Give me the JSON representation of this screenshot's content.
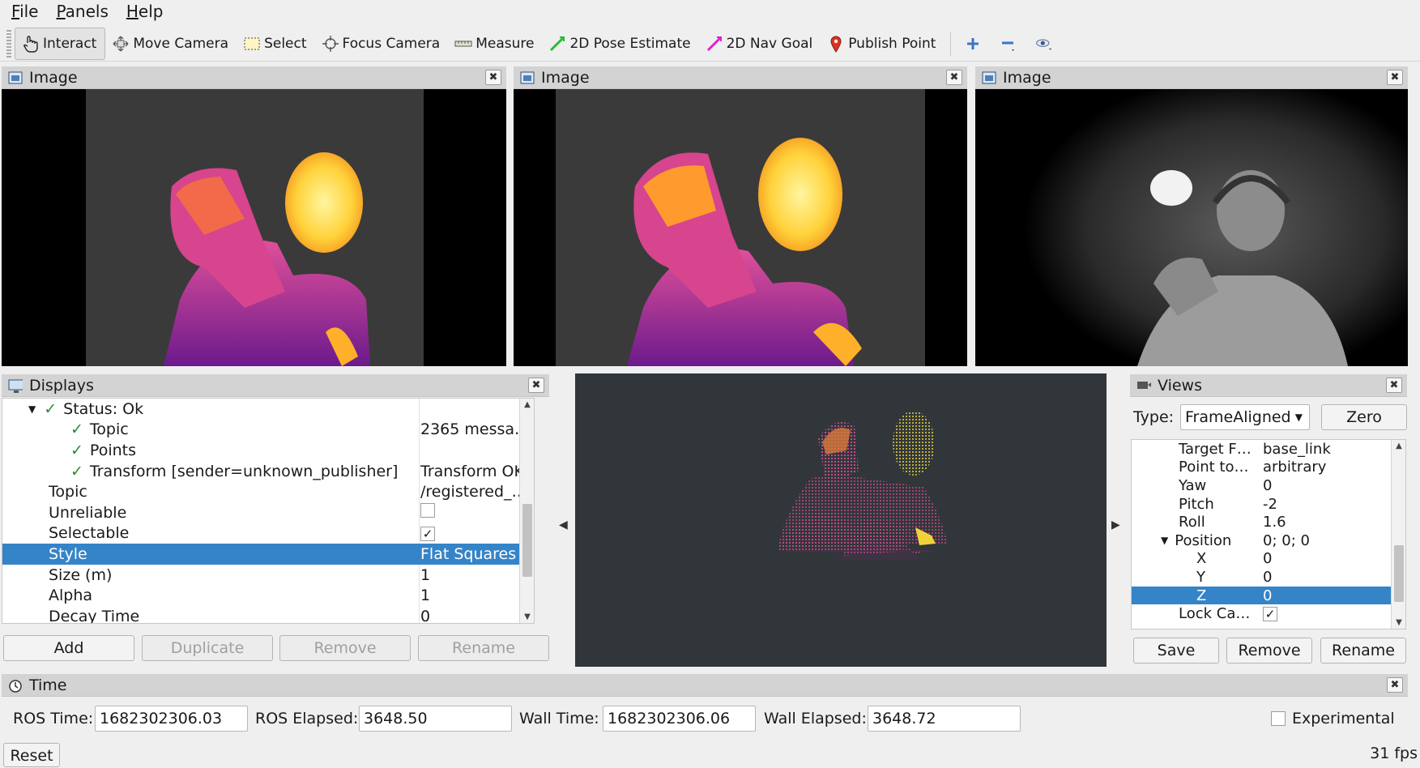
{
  "menu": [
    {
      "letter": "F",
      "rest": "ile"
    },
    {
      "letter": "P",
      "rest": "anels"
    },
    {
      "letter": "H",
      "rest": "elp"
    }
  ],
  "toolbar": {
    "interact": "Interact",
    "move_camera": "Move Camera",
    "select": "Select",
    "focus_camera": "Focus Camera",
    "measure": "Measure",
    "pose_estimate": "2D Pose Estimate",
    "nav_goal": "2D Nav Goal",
    "publish_point": "Publish Point"
  },
  "image_panels": [
    {
      "title": "Image",
      "icon": "image-icon"
    },
    {
      "title": "Image",
      "icon": "image-icon"
    },
    {
      "title": "Image",
      "icon": "image-icon"
    }
  ],
  "displays": {
    "title": "Displays",
    "rows": [
      {
        "name": "Status: Ok",
        "value": ""
      },
      {
        "name": "Topic",
        "value": "2365 messa…"
      },
      {
        "name": "Points",
        "value": ""
      },
      {
        "name": "Transform [sender=unknown_publisher]",
        "value": "Transform OK"
      },
      {
        "name": "Topic",
        "value": "/registered_…"
      },
      {
        "name": "Unreliable",
        "value": ""
      },
      {
        "name": "Selectable",
        "value": "✓"
      },
      {
        "name": "Style",
        "value": "Flat Squares"
      },
      {
        "name": "Size (m)",
        "value": "1"
      },
      {
        "name": "Alpha",
        "value": "1"
      },
      {
        "name": "Decay Time",
        "value": "0"
      }
    ],
    "buttons": {
      "add": "Add",
      "duplicate": "Duplicate",
      "remove": "Remove",
      "rename": "Rename"
    }
  },
  "views": {
    "title": "Views",
    "type_label": "Type:",
    "type_value": "FrameAligned",
    "zero": "Zero",
    "rows": [
      {
        "name": "Target F…",
        "value": "base_link"
      },
      {
        "name": "Point to…",
        "value": "arbitrary"
      },
      {
        "name": "Yaw",
        "value": "0"
      },
      {
        "name": "Pitch",
        "value": "-2"
      },
      {
        "name": "Roll",
        "value": "1.6"
      },
      {
        "name": "Position",
        "value": "0; 0; 0"
      },
      {
        "name": "X",
        "value": "0"
      },
      {
        "name": "Y",
        "value": "0"
      },
      {
        "name": "Z",
        "value": "0"
      },
      {
        "name": "Lock Ca…",
        "value": "✓"
      }
    ],
    "buttons": {
      "save": "Save",
      "remove": "Remove",
      "rename": "Rename"
    }
  },
  "time": {
    "title": "Time",
    "ros_time_label": "ROS Time:",
    "ros_time": "1682302306.03",
    "ros_elapsed_label": "ROS Elapsed:",
    "ros_elapsed": "3648.50",
    "wall_time_label": "Wall Time:",
    "wall_time": "1682302306.06",
    "wall_elapsed_label": "Wall Elapsed:",
    "wall_elapsed": "3648.72",
    "experimental": "Experimental",
    "reset": "Reset",
    "fps": "31 fps"
  }
}
